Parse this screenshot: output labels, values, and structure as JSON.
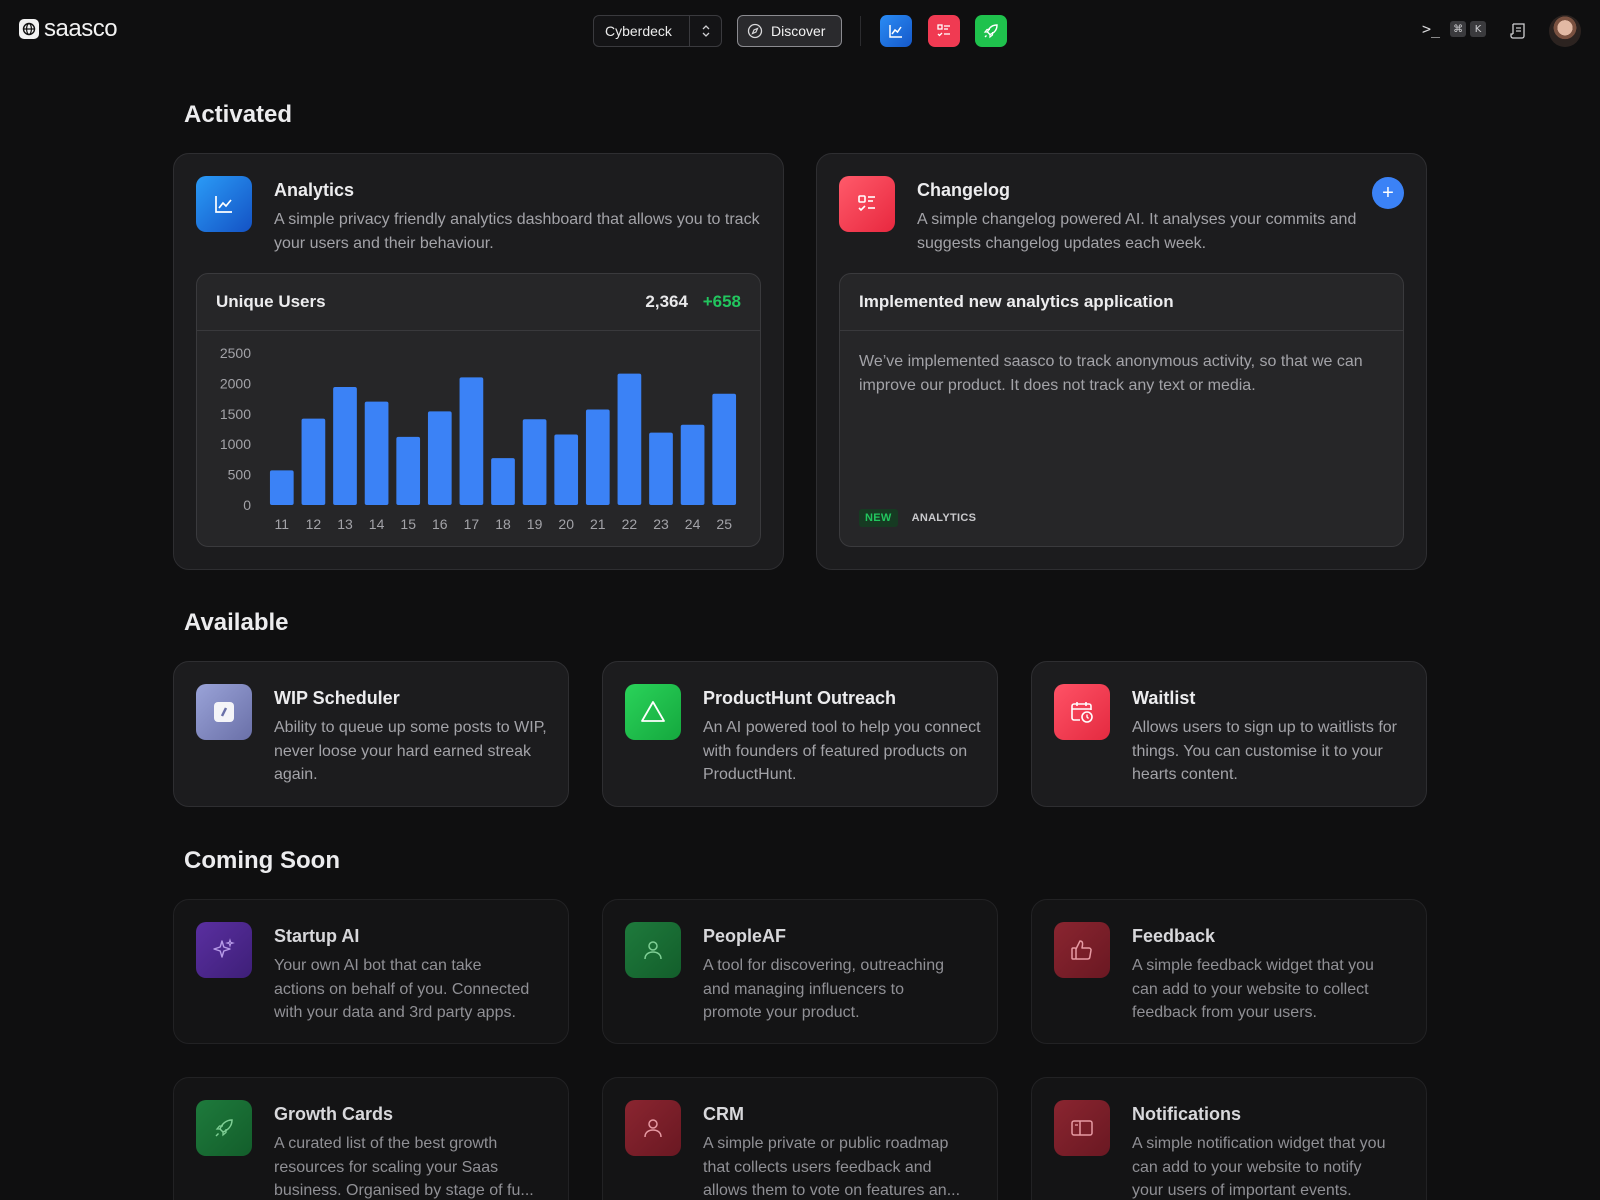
{
  "brand": {
    "name": "saasco"
  },
  "topbar": {
    "workspace": "Cyberdeck",
    "discover_label": "Discover",
    "shortcut_keys": [
      "⌘",
      "K"
    ],
    "apps": [
      {
        "icon": "line-chart-icon",
        "color": "#1d6fe0"
      },
      {
        "icon": "checklist-icon",
        "color": "#f0344f"
      },
      {
        "icon": "rocket-icon",
        "color": "#22c55e"
      }
    ]
  },
  "sections": {
    "activated": "Activated",
    "available": "Available",
    "coming_soon": "Coming Soon"
  },
  "analytics": {
    "title": "Analytics",
    "description": "A simple privacy friendly analytics dashboard that allows you to track your users and their behaviour.",
    "panel_title": "Unique Users",
    "total": "2,364",
    "delta": "+658"
  },
  "changelog": {
    "title": "Changelog",
    "description": "A simple changelog powered AI. It analyses your commits and suggests changelog updates each week.",
    "entry_title": "Implemented new analytics application",
    "entry_body": "We’ve implemented saasco to track anonymous activity, so that we can improve our product. It does not track any text or media.",
    "tag_new": "NEW",
    "tag_category": "ANALYTICS"
  },
  "available": [
    {
      "title": "WIP Scheduler",
      "description": "Ability to queue up some posts to WIP, never loose your hard earned streak again.",
      "icon": "wip-icon"
    },
    {
      "title": "ProductHunt Outreach",
      "description": "An AI powered tool to help you connect with founders of featured products on ProductHunt.",
      "icon": "triangle-icon"
    },
    {
      "title": "Waitlist",
      "description": "Allows users to sign up to waitlists for things. You can customise it to your hearts content.",
      "icon": "calendar-clock-icon"
    }
  ],
  "coming_soon": [
    {
      "title": "Startup AI",
      "line1": "Your own AI bot that can take",
      "line2": "actions on behalf of you. Connected",
      "line3": "with your data and 3rd party apps.",
      "icon": "sparkles-icon"
    },
    {
      "title": "PeopleAF",
      "line1": "A tool for discovering, outreaching",
      "line2": "and managing influencers to",
      "line3": "promote your product.",
      "icon": "person-icon"
    },
    {
      "title": "Feedback",
      "line1": "A simple feedback widget that you",
      "line2": "can add to your website to collect",
      "line3": "feedback from your users.",
      "icon": "thumbs-up-icon"
    },
    {
      "title": "Growth Cards",
      "line1": "A curated list of the best growth",
      "line2": "resources for scaling your Saas",
      "line3": "business. Organised by stage of fu...",
      "icon": "rocket-icon"
    },
    {
      "title": "CRM",
      "line1": "A simple private or public roadmap",
      "line2": "that collects users feedback and",
      "line3": "allows them to vote on features an...",
      "icon": "person-icon"
    },
    {
      "title": "Notifications",
      "line1": "A simple notification widget that you",
      "line2": "can add to your website to notify",
      "line3": "your users of important events.",
      "icon": "inbox-icon"
    }
  ],
  "chart_data": {
    "type": "bar",
    "categories": [
      "11",
      "12",
      "13",
      "14",
      "15",
      "16",
      "17",
      "18",
      "19",
      "20",
      "21",
      "22",
      "23",
      "24",
      "25"
    ],
    "values": [
      570,
      1420,
      1940,
      1700,
      1120,
      1540,
      2100,
      770,
      1410,
      1160,
      1570,
      2160,
      1190,
      1320,
      1830
    ],
    "ylim": [
      0,
      2500
    ],
    "yticks": [
      0,
      500,
      1000,
      1500,
      2000,
      2500
    ],
    "bar_color": "#3b82f6",
    "grid": false
  }
}
